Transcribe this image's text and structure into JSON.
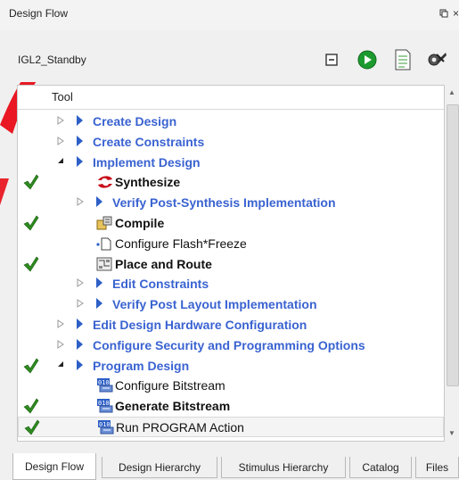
{
  "window": {
    "title": "Design Flow",
    "pin_glyph": "▫",
    "close_glyph": "×"
  },
  "toolbar": {
    "project": "IGL2_Standby",
    "buttons": [
      {
        "name": "collapse-all-icon"
      },
      {
        "name": "run-icon"
      },
      {
        "name": "report-icon"
      },
      {
        "name": "options-icon"
      }
    ]
  },
  "tree": {
    "column_header": "Tool",
    "rows": [
      {
        "label": "Create Design",
        "style": "link",
        "indent": 0,
        "expander": "▷",
        "checked": false
      },
      {
        "label": "Create Constraints",
        "style": "link",
        "indent": 0,
        "expander": "▷",
        "checked": false
      },
      {
        "label": "Implement Design",
        "style": "link",
        "indent": 0,
        "expander": "◢",
        "checked": false
      },
      {
        "label": "Synthesize",
        "style": "bold",
        "indent": 1,
        "icon": "synthesize-icon",
        "checked": true
      },
      {
        "label": "Verify Post-Synthesis Implementation",
        "style": "link",
        "indent": 1,
        "expander": "▷",
        "checked": false
      },
      {
        "label": "Compile",
        "style": "bold",
        "indent": 1,
        "icon": "compile-icon",
        "checked": true
      },
      {
        "label": "Configure Flash*Freeze",
        "style": "plain",
        "indent": 1,
        "icon": "configure-icon",
        "checked": false
      },
      {
        "label": "Place and Route",
        "style": "bold",
        "indent": 1,
        "icon": "place-route-icon",
        "checked": true
      },
      {
        "label": "Edit Constraints",
        "style": "link",
        "indent": 1,
        "expander": "▷",
        "checked": false
      },
      {
        "label": "Verify Post Layout Implementation",
        "style": "link",
        "indent": 1,
        "expander": "▷",
        "checked": false
      },
      {
        "label": "Edit Design Hardware Configuration",
        "style": "link",
        "indent": 0,
        "expander": "▷",
        "checked": false
      },
      {
        "label": "Configure Security and Programming Options",
        "style": "link",
        "indent": 0,
        "expander": "▷",
        "checked": false
      },
      {
        "label": "Program Design",
        "style": "link",
        "indent": 0,
        "expander": "◢",
        "checked": true
      },
      {
        "label": "Configure Bitstream",
        "style": "plain",
        "indent": 1,
        "icon": "bitstream-icon",
        "checked": false
      },
      {
        "label": "Generate Bitstream",
        "style": "bold",
        "indent": 1,
        "icon": "bitstream-icon",
        "checked": true
      },
      {
        "label": "Run PROGRAM Action",
        "style": "plain",
        "indent": 1,
        "icon": "bitstream-icon",
        "checked": true,
        "selected": true
      }
    ]
  },
  "tabs": [
    {
      "label": "Design Flow",
      "active": true
    },
    {
      "label": "Design Hierarchy",
      "active": false
    },
    {
      "label": "Stimulus Hierarchy",
      "active": false
    },
    {
      "label": "Catalog",
      "active": false
    },
    {
      "label": "Files",
      "active": false
    }
  ],
  "colors": {
    "link": "#3a63d1",
    "check": "#2e8b1f",
    "watermark": "#e8000b"
  }
}
